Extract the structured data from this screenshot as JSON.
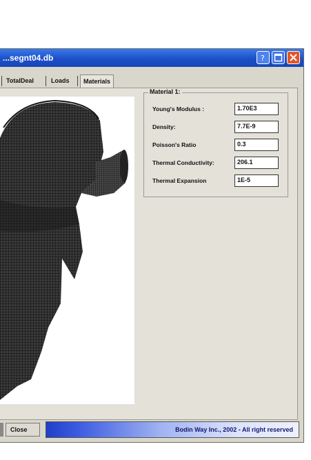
{
  "window": {
    "title": "...segnt04.db",
    "buttons": [
      "help",
      "maximize",
      "close"
    ]
  },
  "tabs": [
    {
      "label": "TotalDeal"
    },
    {
      "label": "Loads"
    },
    {
      "label": "Materials",
      "active": true
    }
  ],
  "material": {
    "group_title": "Material 1:",
    "properties": [
      {
        "label": "Young's Modulus :",
        "value": "1.70E3"
      },
      {
        "label": "Density:",
        "value": "7.7E-9"
      },
      {
        "label": "Poisson's Ratio",
        "value": "0.3"
      },
      {
        "label": "Thermal Conductivity:",
        "value": "206.1"
      },
      {
        "label": "Thermal Expansion",
        "value": "1E-5"
      }
    ]
  },
  "footer": {
    "close_label": "Close",
    "copyright": "Bodin Way Inc., 2002 - All right reserved"
  },
  "colors": {
    "titlebar": "#1c4fc8",
    "window_bg": "#d9d7cc",
    "close_button": "#e25628",
    "progress_start": "#1f3fc6"
  }
}
